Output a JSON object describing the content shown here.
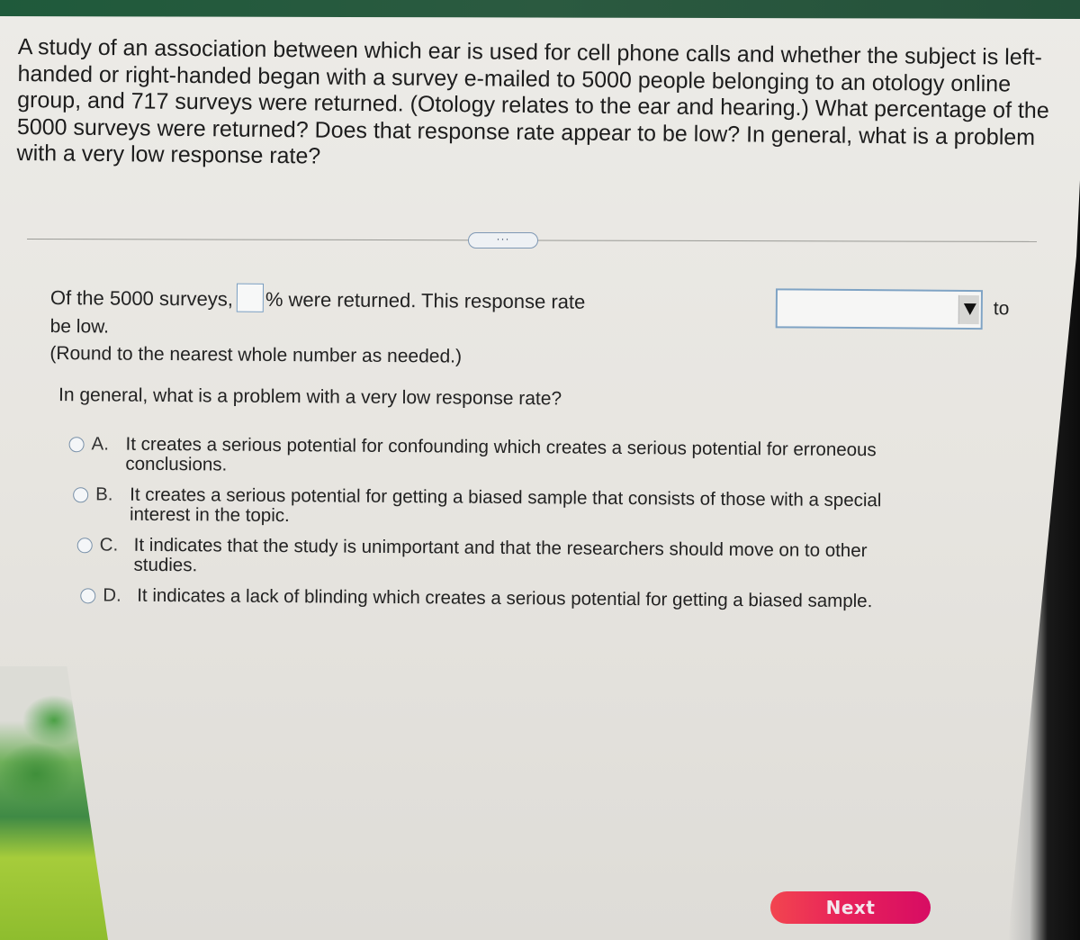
{
  "question": {
    "text": "A study of an association between which ear is used for cell phone calls and whether the subject is left-handed or right-handed began with a survey e-mailed to 5000 people belonging to an otology online group, and 717 surveys were returned. (Otology relates to the ear and hearing.) What percentage of the 5000 surveys were returned? Does that response rate appear to be low? In general, what is a problem with a very low response rate?"
  },
  "more_button": {
    "label": "···",
    "icon": "ellipsis-icon"
  },
  "answer": {
    "prefix": "Of the 5000 surveys,",
    "percent_input": {
      "value": "",
      "placeholder": ""
    },
    "mid_text": "% were returned. This response rate",
    "rate_select": {
      "selected": "",
      "icon": "caret-down-icon"
    },
    "after_select": "to",
    "line2": "be low.",
    "round_note": "(Round to the nearest whole number as needed.)"
  },
  "mc": {
    "question": "In general, what is a problem with a very low response rate?",
    "options": [
      {
        "letter": "A.",
        "text": "It creates a serious potential for confounding which creates a serious potential for erroneous conclusions.",
        "selected": false
      },
      {
        "letter": "B.",
        "text": "It creates a serious potential for getting a biased sample that consists of those with a special interest in the topic.",
        "selected": false
      },
      {
        "letter": "C.",
        "text": "It indicates that the study is unimportant and that the researchers should move on to other studies.",
        "selected": false
      },
      {
        "letter": "D.",
        "text": "It indicates a lack of blinding which creates a serious potential for getting a biased sample.",
        "selected": false
      }
    ]
  },
  "next_button": {
    "label": "Next",
    "color_start": "#f2454f",
    "color_end": "#d70c63"
  }
}
